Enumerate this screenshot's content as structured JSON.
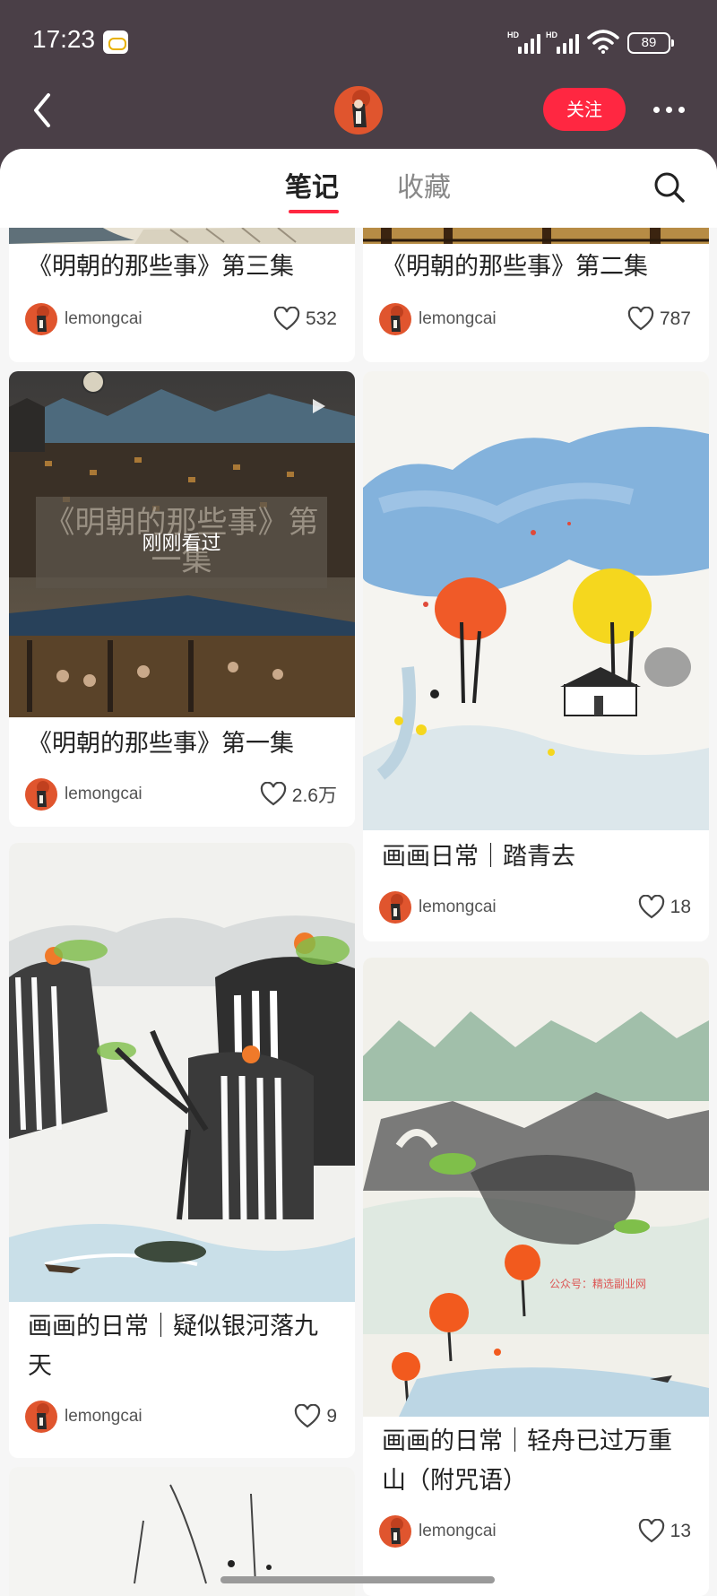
{
  "status_bar": {
    "time": "17:23",
    "signal_1_label": "HD",
    "signal_2_label": "HD",
    "battery": "89",
    "icons": [
      "app-notification-icon",
      "signal-icon",
      "wifi-icon",
      "battery-icon"
    ]
  },
  "header": {
    "follow_label": "关注",
    "back_icon": "chevron-left-icon",
    "more_icon": "more-dots-icon"
  },
  "tabs": {
    "notes": "笔记",
    "collections": "收藏",
    "active": "notes",
    "search_icon": "search-icon"
  },
  "colors": {
    "accent": "#ff2741",
    "status_bg": "#4a3f47",
    "feed_bg": "#f6f6f6"
  },
  "feed": {
    "left": [
      {
        "title": "《明朝的那些事》第三集",
        "author": "lemongcai",
        "likes": "532"
      },
      {
        "title": "《明朝的那些事》第一集",
        "author": "lemongcai",
        "likes": "2.6万",
        "overlay_title": "《明朝的那些事》第一集",
        "overlay_label": "刚刚看过",
        "is_video": true
      },
      {
        "title": "画画的日常｜疑似银河落九天",
        "author": "lemongcai",
        "likes": "9"
      }
    ],
    "right": [
      {
        "title": "《明朝的那些事》第二集",
        "author": "lemongcai",
        "likes": "787"
      },
      {
        "title": "画画日常｜踏青去",
        "author": "lemongcai",
        "likes": "18"
      },
      {
        "title": "画画的日常｜轻舟已过万重山（附咒语）",
        "author": "lemongcai",
        "likes": "13",
        "watermark": "公众号：精选副业网"
      }
    ]
  }
}
